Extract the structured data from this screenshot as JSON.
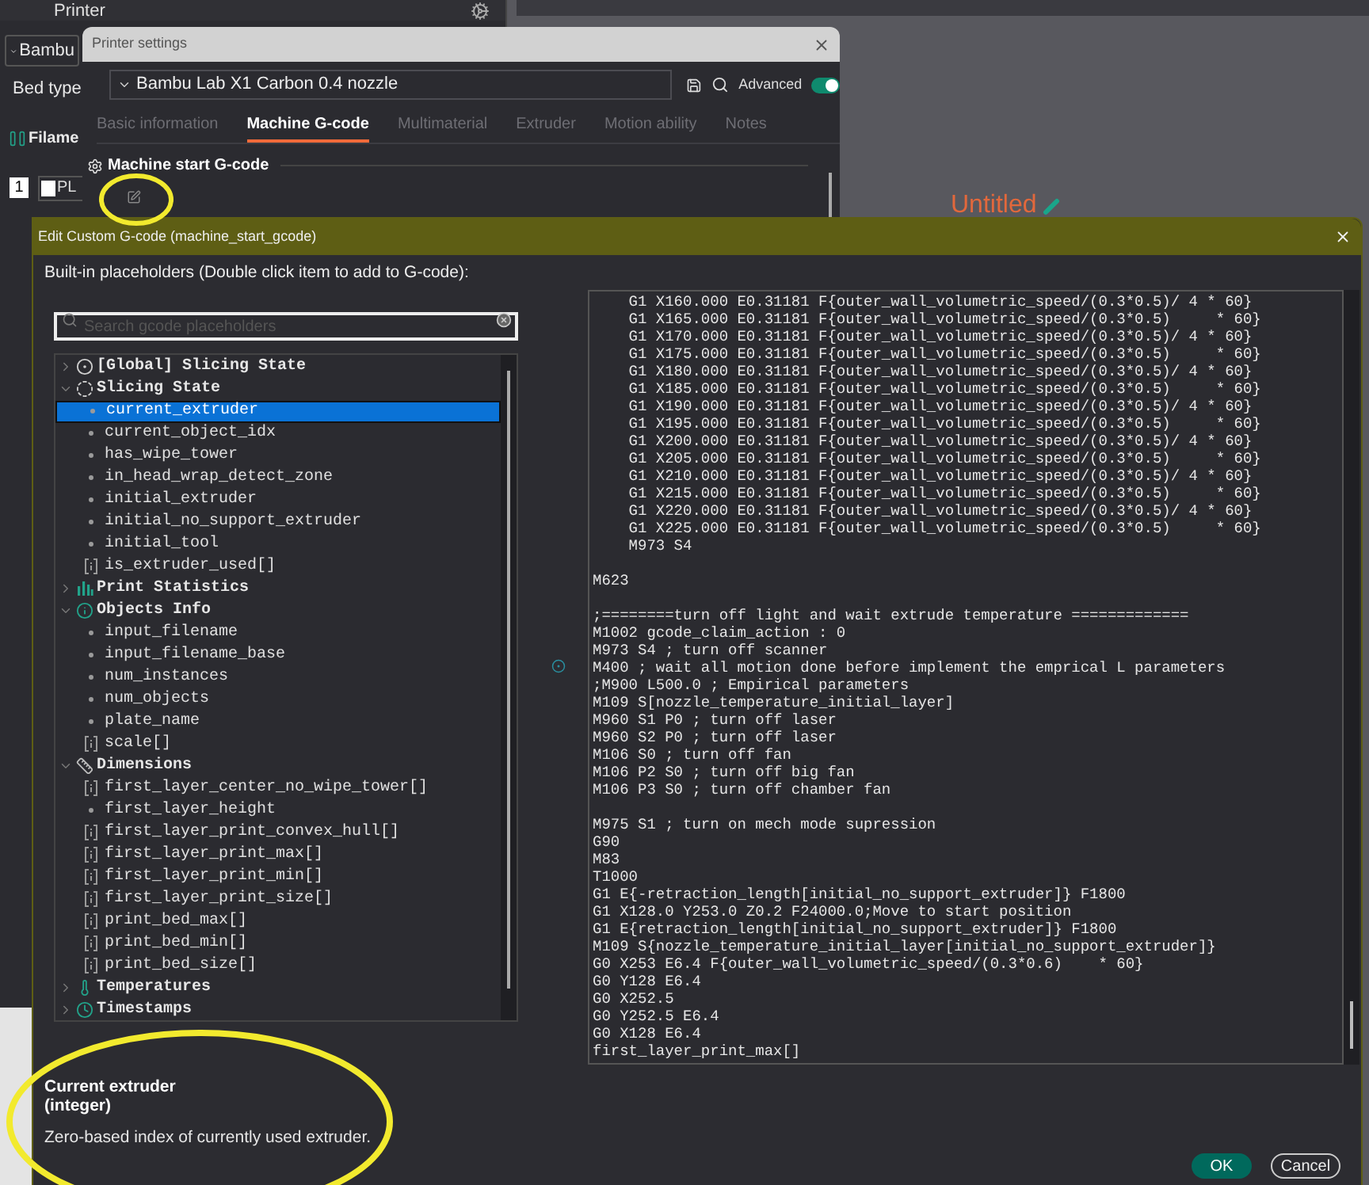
{
  "background_app": {
    "panel_title": "Printer",
    "printer_preset": "Bambu",
    "bed_type_label": "Bed type",
    "filament_heading": "Filame",
    "filament_index": "1",
    "filament_name": "PL",
    "plate_title": "Untitled"
  },
  "printer_settings": {
    "title": "Printer settings",
    "preset": "Bambu Lab X1 Carbon 0.4 nozzle",
    "advanced_label": "Advanced",
    "advanced_on": true,
    "tabs": [
      {
        "label": "Basic information",
        "selected": false
      },
      {
        "label": "Machine G-code",
        "selected": true
      },
      {
        "label": "Multimaterial",
        "selected": false
      },
      {
        "label": "Extruder",
        "selected": false
      },
      {
        "label": "Motion ability",
        "selected": false
      },
      {
        "label": "Notes",
        "selected": false
      }
    ],
    "section_title": "Machine start G-code"
  },
  "edit_dialog": {
    "title": "Edit Custom G-code (machine_start_gcode)",
    "hint": "Built-in placeholders (Double click item to add to G-code):",
    "search": {
      "placeholder": "Search gcode placeholders"
    },
    "tree": [
      {
        "label": "[Global] Slicing State",
        "kind": "global",
        "expanded": false
      },
      {
        "label": "Slicing State",
        "kind": "state",
        "expanded": true,
        "children": [
          {
            "label": "current_extruder",
            "kind": "value",
            "selected": true
          },
          {
            "label": "current_object_idx",
            "kind": "value",
            "selected": false
          },
          {
            "label": "has_wipe_tower",
            "kind": "value",
            "selected": false
          },
          {
            "label": "in_head_wrap_detect_zone",
            "kind": "value",
            "selected": false
          },
          {
            "label": "initial_extruder",
            "kind": "value",
            "selected": false
          },
          {
            "label": "initial_no_support_extruder",
            "kind": "value",
            "selected": false
          },
          {
            "label": "initial_tool",
            "kind": "value",
            "selected": false
          },
          {
            "label": "is_extruder_used[]",
            "kind": "array",
            "selected": false
          }
        ]
      },
      {
        "label": "Print Statistics",
        "kind": "statistics",
        "expanded": false
      },
      {
        "label": "Objects Info",
        "kind": "info",
        "expanded": true,
        "children": [
          {
            "label": "input_filename",
            "kind": "value",
            "selected": false
          },
          {
            "label": "input_filename_base",
            "kind": "value",
            "selected": false
          },
          {
            "label": "num_instances",
            "kind": "value",
            "selected": false
          },
          {
            "label": "num_objects",
            "kind": "value",
            "selected": false
          },
          {
            "label": "plate_name",
            "kind": "value",
            "selected": false
          },
          {
            "label": "scale[]",
            "kind": "array",
            "selected": false
          }
        ]
      },
      {
        "label": "Dimensions",
        "kind": "dimensions",
        "expanded": true,
        "children": [
          {
            "label": "first_layer_center_no_wipe_tower[]",
            "kind": "array",
            "selected": false
          },
          {
            "label": "first_layer_height",
            "kind": "value",
            "selected": false
          },
          {
            "label": "first_layer_print_convex_hull[]",
            "kind": "array",
            "selected": false
          },
          {
            "label": "first_layer_print_max[]",
            "kind": "array",
            "selected": false
          },
          {
            "label": "first_layer_print_min[]",
            "kind": "array",
            "selected": false
          },
          {
            "label": "first_layer_print_size[]",
            "kind": "array",
            "selected": false
          },
          {
            "label": "print_bed_max[]",
            "kind": "array",
            "selected": false
          },
          {
            "label": "print_bed_min[]",
            "kind": "array",
            "selected": false
          },
          {
            "label": "print_bed_size[]",
            "kind": "array",
            "selected": false
          }
        ]
      },
      {
        "label": "Temperatures",
        "kind": "temperatures",
        "expanded": false
      },
      {
        "label": "Timestamps",
        "kind": "timestamps",
        "expanded": false
      }
    ],
    "code": "    G1 X160.000 E0.31181 F{outer_wall_volumetric_speed/(0.3*0.5)/ 4 * 60}\n    G1 X165.000 E0.31181 F{outer_wall_volumetric_speed/(0.3*0.5)     * 60}\n    G1 X170.000 E0.31181 F{outer_wall_volumetric_speed/(0.3*0.5)/ 4 * 60}\n    G1 X175.000 E0.31181 F{outer_wall_volumetric_speed/(0.3*0.5)     * 60}\n    G1 X180.000 E0.31181 F{outer_wall_volumetric_speed/(0.3*0.5)/ 4 * 60}\n    G1 X185.000 E0.31181 F{outer_wall_volumetric_speed/(0.3*0.5)     * 60}\n    G1 X190.000 E0.31181 F{outer_wall_volumetric_speed/(0.3*0.5)/ 4 * 60}\n    G1 X195.000 E0.31181 F{outer_wall_volumetric_speed/(0.3*0.5)     * 60}\n    G1 X200.000 E0.31181 F{outer_wall_volumetric_speed/(0.3*0.5)/ 4 * 60}\n    G1 X205.000 E0.31181 F{outer_wall_volumetric_speed/(0.3*0.5)     * 60}\n    G1 X210.000 E0.31181 F{outer_wall_volumetric_speed/(0.3*0.5)/ 4 * 60}\n    G1 X215.000 E0.31181 F{outer_wall_volumetric_speed/(0.3*0.5)     * 60}\n    G1 X220.000 E0.31181 F{outer_wall_volumetric_speed/(0.3*0.5)/ 4 * 60}\n    G1 X225.000 E0.31181 F{outer_wall_volumetric_speed/(0.3*0.5)     * 60}\n    M973 S4\n\nM623\n\n;========turn off light and wait extrude temperature =============\nM1002 gcode_claim_action : 0\nM973 S4 ; turn off scanner\nM400 ; wait all motion done before implement the emprical L parameters\n;M900 L500.0 ; Empirical parameters\nM109 S[nozzle_temperature_initial_layer]\nM960 S1 P0 ; turn off laser\nM960 S2 P0 ; turn off laser\nM106 S0 ; turn off fan\nM106 P2 S0 ; turn off big fan\nM106 P3 S0 ; turn off chamber fan\n\nM975 S1 ; turn on mech mode supression\nG90\nM83\nT1000\nG1 E{-retraction_length[initial_no_support_extruder]} F1800\nG1 X128.0 Y253.0 Z0.2 F24000.0;Move to start position\nG1 E{retraction_length[initial_no_support_extruder]} F1800\nM109 S{nozzle_temperature_initial_layer[initial_no_support_extruder]}\nG0 X253 E6.4 F{outer_wall_volumetric_speed/(0.3*0.6)    * 60}\nG0 Y128 E6.4\nG0 X252.5\nG0 Y252.5 E6.4\nG0 X128 E6.4\nfirst_layer_print_max[]",
    "description": {
      "title": "Current extruder",
      "type": "(integer)",
      "text": "Zero-based index of currently used extruder."
    },
    "buttons": [
      {
        "label": "OK",
        "kind": "primary"
      },
      {
        "label": "Cancel",
        "kind": "secondary"
      }
    ]
  }
}
